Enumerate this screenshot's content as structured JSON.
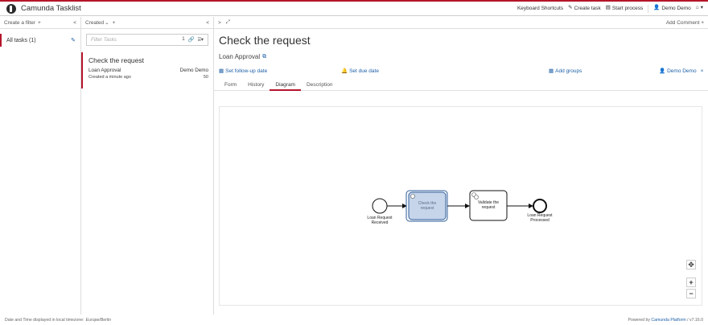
{
  "header": {
    "app_title": "Camunda Tasklist",
    "keyboard_shortcuts": "Keyboard Shortcuts",
    "create_task": "Create task",
    "start_process": "Start process",
    "user": "Demo Demo",
    "home_icon": "home-icon"
  },
  "filters": {
    "create_filter": "Create a filter",
    "add_symbol": "+",
    "collapse": "<",
    "items": [
      {
        "label": "All tasks (1)"
      }
    ]
  },
  "list": {
    "sort_label": "Created",
    "add_symbol": "+",
    "collapse": "<",
    "search_placeholder": "Filter Tasks",
    "count": "1",
    "tasks": [
      {
        "name": "Check the request",
        "process": "Loan Approval",
        "assignee": "Demo Demo",
        "created": "Created a minute ago",
        "priority": "50"
      }
    ]
  },
  "detail": {
    "expand": ">",
    "add_comment": "Add Comment",
    "add_symbol": "+",
    "title": "Check the request",
    "process_name": "Loan Approval",
    "follow_up": "Set follow-up date",
    "due_date": "Set due date",
    "add_groups": "Add groups",
    "assignee": "Demo Demo",
    "remove_symbol": "×",
    "tabs": [
      "Form",
      "History",
      "Diagram",
      "Description"
    ],
    "active_tab": "Diagram"
  },
  "diagram": {
    "start_event_label_1": "Loan Request",
    "start_event_label_2": "Received",
    "task1_label_1": "Check the",
    "task1_label_2": "request",
    "task2_label_1": "Validate the",
    "task2_label_2": "request",
    "end_event_label_1": "Loan Request",
    "end_event_label_2": "Processed",
    "colors": {
      "highlight": "#c6d5ea",
      "highlight_border": "#2e5c9a",
      "stroke": "#111111"
    }
  },
  "zoom": {
    "reset": "✥",
    "in": "+",
    "out": "−"
  },
  "footer": {
    "timezone_text": "Date and Time displayed in local timezone:",
    "timezone": "Europe/Berlin",
    "powered_by": "Powered by",
    "platform": "Camunda Platform",
    "version": "/ v7.16.0"
  },
  "colors": {
    "accent": "#b5152b",
    "link": "#1e5fa6"
  }
}
